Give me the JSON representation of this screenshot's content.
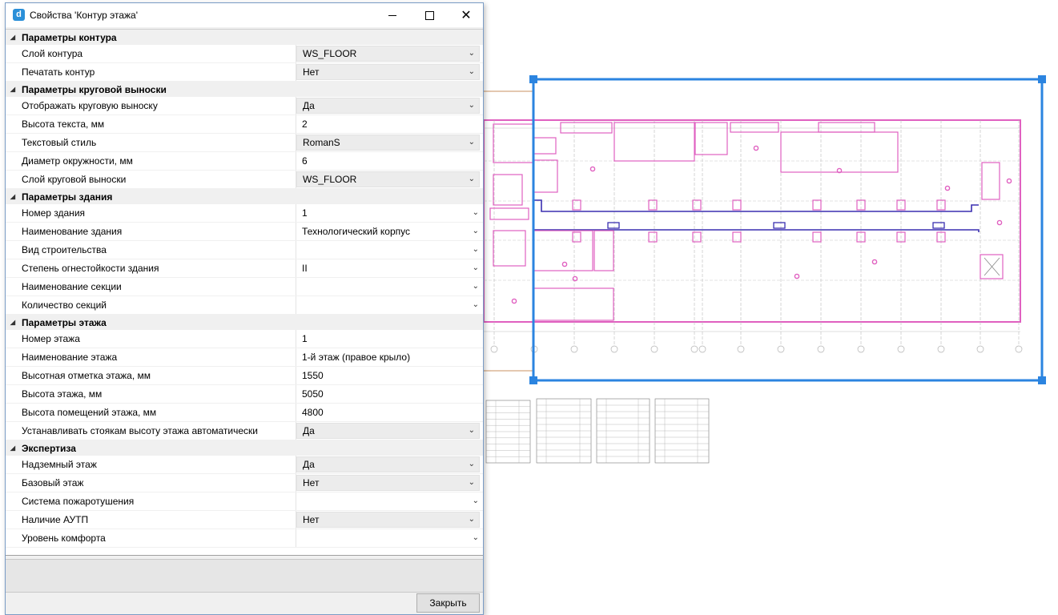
{
  "window": {
    "title": "Свойства 'Контур этажа'"
  },
  "categories": [
    {
      "label": "Параметры контура",
      "rows": [
        {
          "name": "Слой контура",
          "value": "WS_FLOOR",
          "combo": true
        },
        {
          "name": "Печатать контур",
          "value": "Нет",
          "combo": true
        }
      ]
    },
    {
      "label": "Параметры круговой выноски",
      "rows": [
        {
          "name": "Отображать круговую выноску",
          "value": "Да",
          "combo": true
        },
        {
          "name": "Высота текста, мм",
          "value": "2",
          "combo": false
        },
        {
          "name": "Текстовый стиль",
          "value": "RomanS",
          "combo": true
        },
        {
          "name": "Диаметр окружности, мм",
          "value": "6",
          "combo": false
        },
        {
          "name": "Слой круговой выноски",
          "value": "WS_FLOOR",
          "combo": true
        }
      ]
    },
    {
      "label": "Параметры здания",
      "rows": [
        {
          "name": "Номер здания",
          "value": "1",
          "combo": false,
          "chevron": true
        },
        {
          "name": "Наименование здания",
          "value": "Технологический корпус",
          "combo": false,
          "chevron": true
        },
        {
          "name": "Вид строительства",
          "value": "",
          "combo": false,
          "chevron": true
        },
        {
          "name": "Степень огнестойкости здания",
          "value": "II",
          "combo": false,
          "chevron": true
        },
        {
          "name": "Наименование секции",
          "value": "",
          "combo": false,
          "chevron": true
        },
        {
          "name": "Количество секций",
          "value": "",
          "combo": false,
          "chevron": true
        }
      ]
    },
    {
      "label": "Параметры этажа",
      "rows": [
        {
          "name": "Номер этажа",
          "value": "1",
          "combo": false
        },
        {
          "name": "Наименование этажа",
          "value": "1-й этаж (правое крыло)",
          "combo": false
        },
        {
          "name": "Высотная отметка этажа, мм",
          "value": "1550",
          "combo": false
        },
        {
          "name": "Высота этажа, мм",
          "value": "5050",
          "combo": false
        },
        {
          "name": "Высота помещений этажа, мм",
          "value": "4800",
          "combo": false
        },
        {
          "name": "Устанавливать стоякам высоту этажа автоматически",
          "value": "Да",
          "combo": true
        }
      ]
    },
    {
      "label": "Экспертиза",
      "rows": [
        {
          "name": "Надземный этаж",
          "value": "Да",
          "combo": true
        },
        {
          "name": "Базовый этаж",
          "value": "Нет",
          "combo": true
        },
        {
          "name": "Система пожаротушения",
          "value": "",
          "combo": false,
          "chevron": true
        },
        {
          "name": "Наличие АУТП",
          "value": "Нет",
          "combo": true
        },
        {
          "name": "Уровень комфорта",
          "value": "",
          "combo": false,
          "chevron": true
        }
      ]
    }
  ],
  "buttons": {
    "close": "Закрыть"
  },
  "colors": {
    "selection": "#2b84e0",
    "walls": "#e060c0",
    "corridor": "#3a2fb0"
  }
}
